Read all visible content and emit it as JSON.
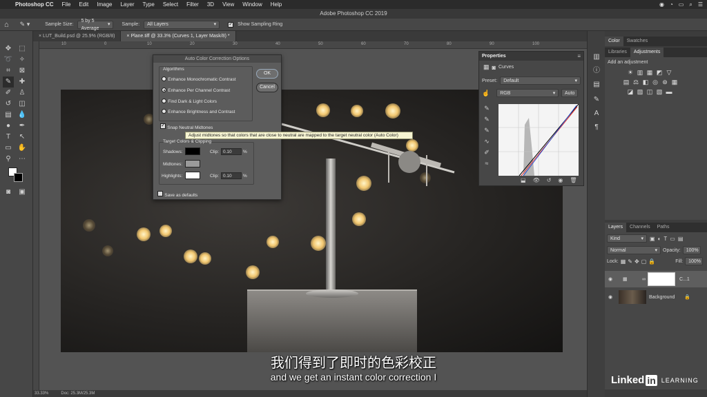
{
  "menubar": {
    "app": "Photoshop CC",
    "items": [
      "File",
      "Edit",
      "Image",
      "Layer",
      "Type",
      "Select",
      "Filter",
      "3D",
      "View",
      "Window",
      "Help"
    ]
  },
  "window_title": "Adobe Photoshop CC 2019",
  "options": {
    "sample_size_label": "Sample Size:",
    "sample_size_value": "5 by 5 Average",
    "sample_label": "Sample:",
    "sample_value": "All Layers",
    "show_ring_label": "Show Sampling Ring"
  },
  "tabs": [
    {
      "label": "LUT_Build.psd @ 25.9% (RGB/8)"
    },
    {
      "label": "Plane.tiff @ 33.3% (Curves 1, Layer Mask/8) *"
    }
  ],
  "ruler_numbers": [
    "10",
    "0",
    "10",
    "20",
    "30",
    "40",
    "50",
    "60",
    "70",
    "80",
    "90",
    "100"
  ],
  "dialog": {
    "title": "Auto Color Correction Options",
    "algorithms_label": "Algorithms",
    "algorithms": [
      {
        "label": "Enhance Monochromatic Contrast",
        "selected": false
      },
      {
        "label": "Enhance Per Channel Contrast",
        "selected": true
      },
      {
        "label": "Find Dark & Light Colors",
        "selected": false
      },
      {
        "label": "Enhance Brightness and Contrast",
        "selected": false
      }
    ],
    "snap_label": "Snap Neutral Midtones",
    "target_label": "Target Colors & Clipping",
    "shadows_label": "Shadows:",
    "midtones_label": "Midtones:",
    "highlights_label": "Highlights:",
    "clip_label": "Clip:",
    "shadows_clip": "0.10",
    "highlights_clip": "0.10",
    "percent": "%",
    "save_defaults_label": "Save as defaults",
    "ok_label": "OK",
    "cancel_label": "Cancel",
    "shadow_color": "#000000",
    "midtone_color": "#9a9a9a",
    "highlight_color": "#ffffff",
    "tooltip": "Adjust midtones so that colors that are close to neutral are mapped to the target neutral color (Auto Color)"
  },
  "properties": {
    "title": "Properties",
    "adjustment": "Curves",
    "preset_label": "Preset:",
    "preset_value": "Default",
    "channel": "RGB",
    "auto_label": "Auto"
  },
  "right_panel": {
    "tabs1": [
      "Color",
      "Swatches"
    ],
    "tabs2": [
      "Libraries",
      "Adjustments"
    ],
    "add_adjustment": "Add an adjustment",
    "layers_tabs": [
      "Layers",
      "Channels",
      "Paths"
    ],
    "kind_label": "Kind",
    "blend_mode": "Normal",
    "opacity_label": "Opacity:",
    "opacity_value": "100%",
    "lock_label": "Lock:",
    "fill_label": "Fill:",
    "fill_value": "100%",
    "layers": [
      {
        "name": "C...1"
      },
      {
        "name": "Background"
      }
    ]
  },
  "status": {
    "zoom": "33.33%",
    "doc": "Doc: 25.3M/25.3M"
  },
  "subtitles": {
    "cn": "我们得到了即时的色彩校正",
    "en": "and we get an instant color correction I"
  },
  "watermark": {
    "brand1": "Linked",
    "brand2": "in",
    "brand3": "LEARNING"
  }
}
